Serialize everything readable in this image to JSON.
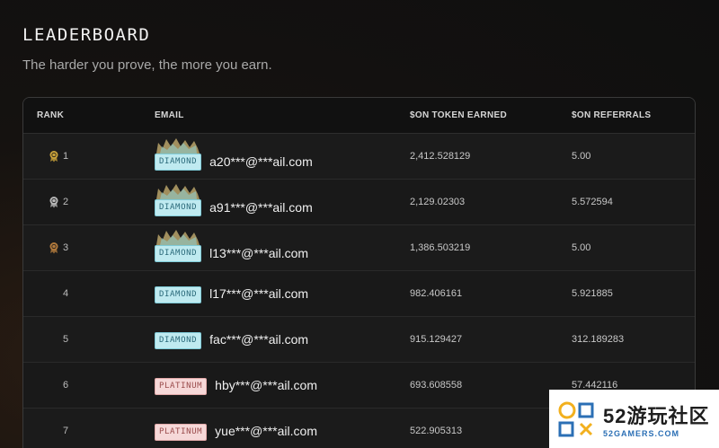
{
  "header": {
    "title": "LEADERBOARD",
    "subtitle": "The harder you prove, the more you earn."
  },
  "table": {
    "columns": [
      "RANK",
      "EMAIL",
      "$ON TOKEN EARNED",
      "$ON REFERRALS"
    ],
    "rows": [
      {
        "rank": "1",
        "medal": "gold",
        "tier": "DIAMOND",
        "email": "a20***@***ail.com",
        "token": "2,412.528129",
        "referrals": "5.00"
      },
      {
        "rank": "2",
        "medal": "silver",
        "tier": "DIAMOND",
        "email": "a91***@***ail.com",
        "token": "2,129.02303",
        "referrals": "5.572594"
      },
      {
        "rank": "3",
        "medal": "bronze",
        "tier": "DIAMOND",
        "email": "l13***@***ail.com",
        "token": "1,386.503219",
        "referrals": "5.00"
      },
      {
        "rank": "4",
        "medal": "",
        "tier": "DIAMOND",
        "email": "l17***@***ail.com",
        "token": "982.406161",
        "referrals": "5.921885"
      },
      {
        "rank": "5",
        "medal": "",
        "tier": "DIAMOND",
        "email": "fac***@***ail.com",
        "token": "915.129427",
        "referrals": "312.189283"
      },
      {
        "rank": "6",
        "medal": "",
        "tier": "PLATINUM",
        "email": "hby***@***ail.com",
        "token": "693.608558",
        "referrals": "57.442116"
      },
      {
        "rank": "7",
        "medal": "",
        "tier": "PLATINUM",
        "email": "yue***@***ail.com",
        "token": "522.905313",
        "referrals": ""
      }
    ]
  },
  "watermark": {
    "big": "52游玩社区",
    "small": "52GAMERS.COM"
  },
  "colors": {
    "gold": "#c9a23a",
    "silver": "#b8b8b8",
    "bronze": "#b27a3c",
    "diamond_bg": "#bfeaf0",
    "platinum_bg": "#f6d8d8"
  }
}
